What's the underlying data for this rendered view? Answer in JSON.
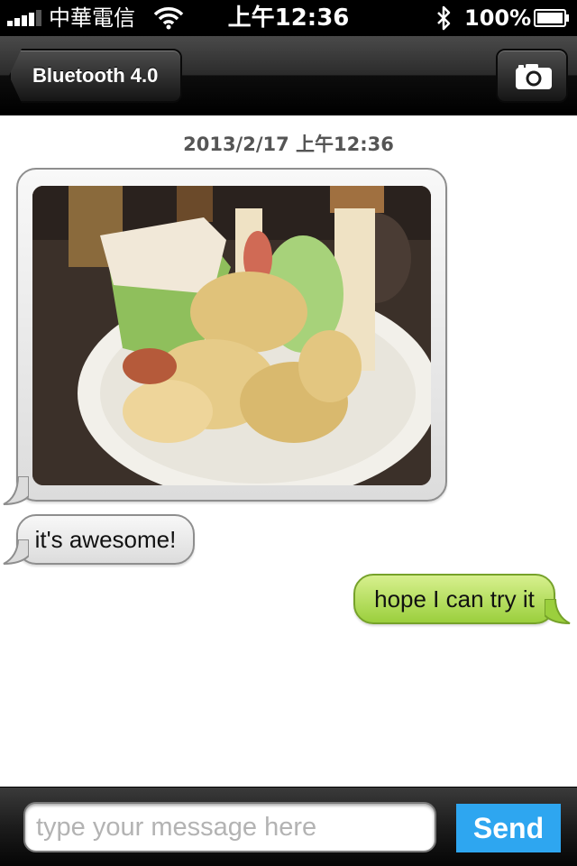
{
  "status_bar": {
    "carrier": "中華電信",
    "time": "上午12:36",
    "battery_percent": "100%",
    "signal_icon": "signal-bars-icon",
    "wifi_icon": "wifi-icon",
    "bluetooth_icon": "bluetooth-icon",
    "battery_icon": "battery-full-icon"
  },
  "nav_bar": {
    "back_label": "Bluetooth 4.0",
    "camera_icon": "camera-icon"
  },
  "chat": {
    "timestamp": "2013/2/17 上午12:36",
    "messages": [
      {
        "direction": "incoming",
        "type": "image",
        "content": "photo of sandwich with chips on a plate"
      },
      {
        "direction": "incoming",
        "type": "text",
        "text": "it's awesome!"
      },
      {
        "direction": "outgoing",
        "type": "text",
        "text": "hope I can try it"
      }
    ]
  },
  "input_bar": {
    "placeholder": "type your message here",
    "value": "",
    "send_label": "Send"
  },
  "colors": {
    "incoming_bubble": "#e6e6e6",
    "outgoing_bubble": "#a9d64a",
    "send_button": "#2ea6f0",
    "bars": "#000000"
  }
}
